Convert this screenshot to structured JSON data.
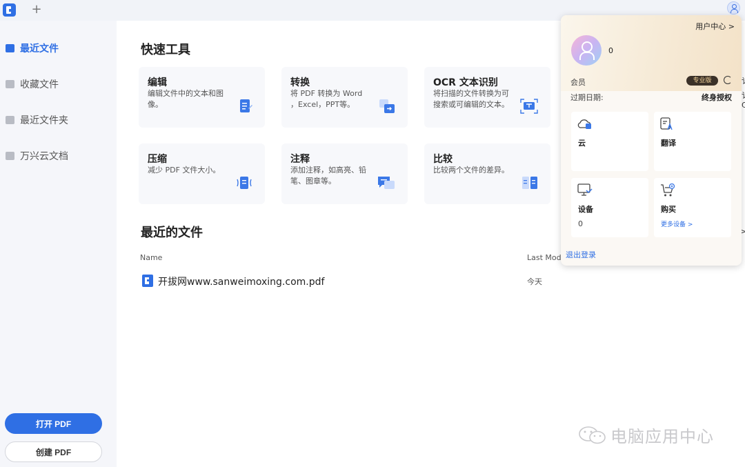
{
  "topbar": {
    "new_tab_label": "+"
  },
  "sidebar": {
    "items": [
      {
        "label": "最近文件",
        "icon": "recent-file-icon",
        "active": true
      },
      {
        "label": "收藏文件",
        "icon": "star-file-icon",
        "active": false
      },
      {
        "label": "最近文件夹",
        "icon": "folder-icon",
        "active": false
      },
      {
        "label": "万兴云文档",
        "icon": "cloud-icon",
        "active": false
      }
    ],
    "open_pdf_label": "打开 PDF",
    "create_pdf_label": "创建 PDF"
  },
  "quick_tools": {
    "title": "快速工具",
    "cards": [
      {
        "title": "编辑",
        "desc": "编辑文件中的文本和图像。",
        "icon": "edit-doc-icon"
      },
      {
        "title": "转换",
        "desc": "将 PDF 转换为 Word ，Excel，PPT等。",
        "icon": "convert-icon"
      },
      {
        "title": "OCR 文本识别",
        "desc": "将扫描的文件转换为可搜索或可编辑的文本。",
        "icon": "ocr-scan-icon"
      },
      {
        "title": "压缩",
        "desc": "减少 PDF 文件大小。",
        "icon": "compress-icon"
      },
      {
        "title": "注释",
        "desc": "添加注释，如高亮、铅笔、图章等。",
        "icon": "comment-icon"
      },
      {
        "title": "比较",
        "desc": "比较两个文件的差异。",
        "icon": "compare-icon"
      }
    ]
  },
  "recent": {
    "title": "最近的文件",
    "columns": {
      "name": "Name",
      "modified": "Last Mod"
    },
    "files": [
      {
        "name": "开拔网www.sanweimoxing.com.pdf",
        "modified": "今天"
      }
    ]
  },
  "user_popup": {
    "user_center_label": "用户中心 >",
    "username": "0",
    "member_label": "会员",
    "member_badge": "专业版",
    "expire_label": "过期日期:",
    "expire_value": "终身授权",
    "tiles": [
      {
        "label": "云",
        "icon": "cloud-upload-icon",
        "sub": ""
      },
      {
        "label": "翻译",
        "icon": "translate-icon",
        "sub": ""
      },
      {
        "label": "设备",
        "icon": "monitor-icon",
        "sub": "0"
      },
      {
        "label": "购买",
        "icon": "cart-icon",
        "link": "更多设备 >"
      }
    ],
    "logout_label": "退出登录"
  },
  "edge_fragments": {
    "a": "讠",
    "b": "讠",
    "c": "C",
    "d": ">"
  },
  "watermark": {
    "text": "电脑应用中心"
  },
  "colors": {
    "accent": "#2f6fe4",
    "badge_bg": "#3b3128",
    "badge_text": "#f4d49a"
  }
}
